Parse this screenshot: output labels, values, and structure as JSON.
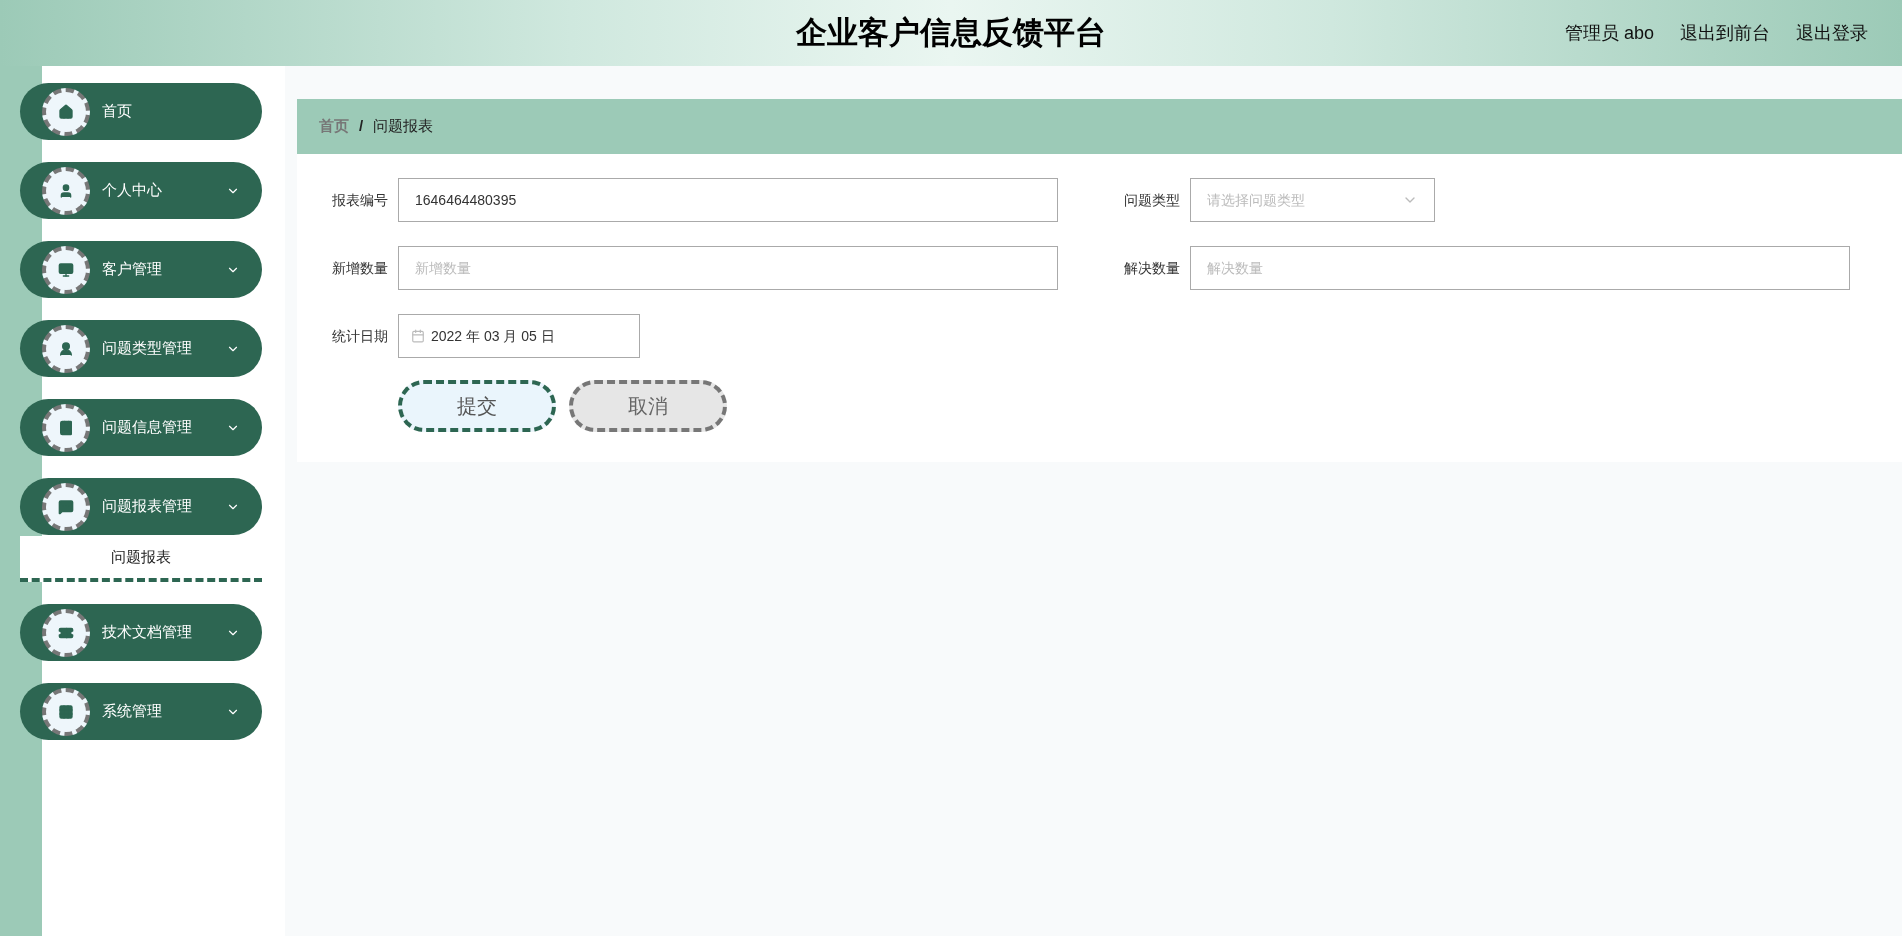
{
  "header": {
    "title": "企业客户信息反馈平台",
    "links": [
      "管理员 abo",
      "退出到前台",
      "退出登录"
    ]
  },
  "sidebar": {
    "items": [
      {
        "kind": "link",
        "label": "首页"
      },
      {
        "kind": "group",
        "label": "个人中心"
      },
      {
        "kind": "group",
        "label": "客户管理"
      },
      {
        "kind": "group",
        "label": "问题类型管理"
      },
      {
        "kind": "group",
        "label": "问题信息管理"
      },
      {
        "kind": "group",
        "label": "问题报表管理",
        "children": [
          {
            "label": "问题报表",
            "selected": true
          }
        ]
      },
      {
        "kind": "group",
        "label": "技术文档管理"
      },
      {
        "kind": "group",
        "label": "系统管理"
      }
    ]
  },
  "breadcrumb": [
    {
      "label": "首页",
      "selected": false
    },
    {
      "label": "问题报表",
      "selected": true
    }
  ],
  "breadcrumb_separator": "/",
  "form": {
    "rows": [
      [
        {
          "kind": "text",
          "label": "报表编号",
          "value": "1646464480395"
        },
        {
          "kind": "select",
          "label": "问题类型",
          "placeholder": "请选择问题类型"
        }
      ],
      [
        {
          "kind": "text",
          "label": "新增数量",
          "placeholder": "新增数量"
        },
        {
          "kind": "text",
          "label": "解决数量",
          "placeholder": "解决数量"
        }
      ],
      [
        {
          "kind": "date",
          "label": "统计日期",
          "value": "2022 年 03 月 05 日"
        }
      ]
    ],
    "buttons": [
      {
        "kind": "primary",
        "label": "提交"
      },
      {
        "kind": "secondary",
        "label": "取消"
      }
    ]
  }
}
